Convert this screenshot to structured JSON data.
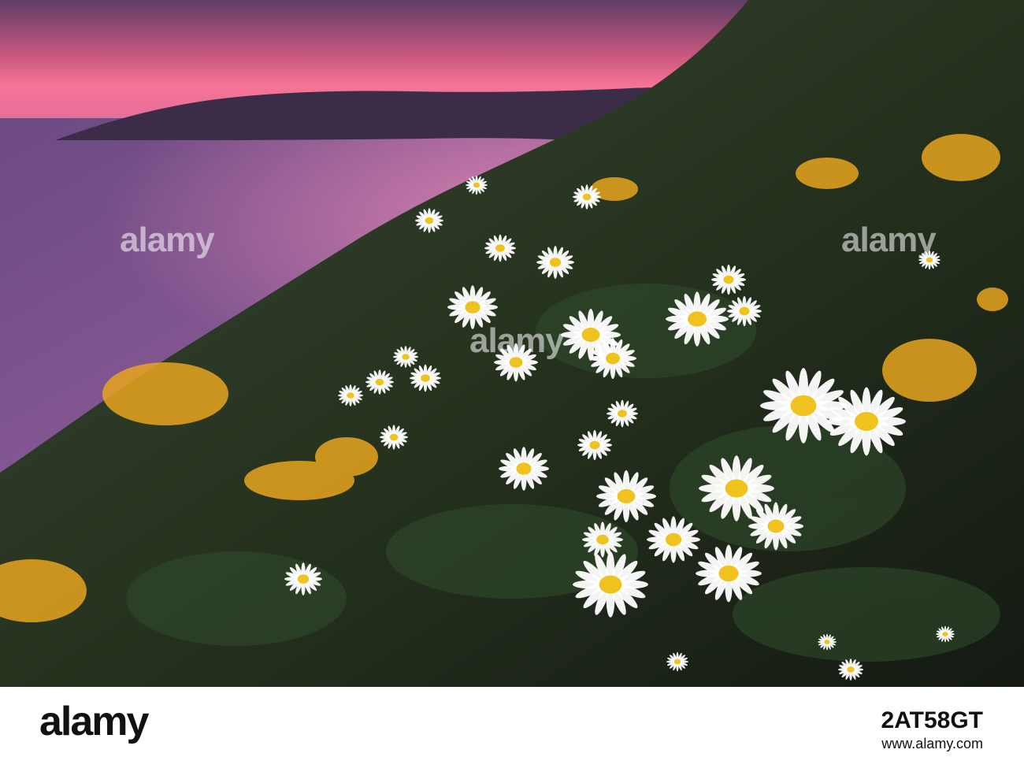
{
  "watermark": {
    "brand": "alamy"
  },
  "footer": {
    "logo_text": "alamy",
    "image_id": "2AT58GT",
    "url": "www.alamy.com"
  },
  "colors": {
    "sky_top": "#5a3c63",
    "sky_glow": "#f06a8f",
    "sea": "#8a5a98",
    "headland": "#3b2c48",
    "slope_dark": "#1f2a22",
    "gorse": "#e7a51f",
    "daisy_petal": "#ffffff",
    "daisy_center": "#f0c21d"
  }
}
